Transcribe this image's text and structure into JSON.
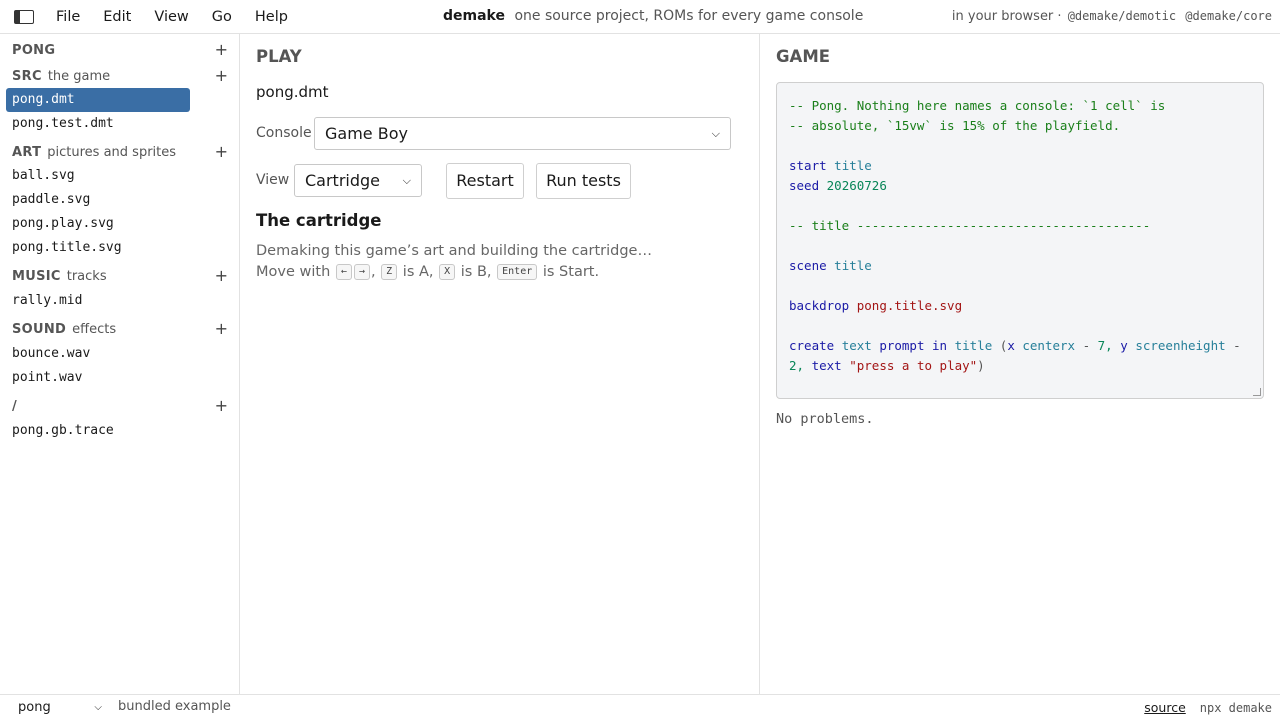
{
  "menubar": {
    "items": [
      "File",
      "Edit",
      "View",
      "Go",
      "Help"
    ],
    "brand": "demake",
    "tagline": "one source project, ROMs for every game console",
    "right_text": "in your browser ·",
    "packages": [
      "@demake/demotic",
      "@demake/core"
    ]
  },
  "sidebar": {
    "sections": [
      {
        "title": "PONG",
        "subtitle": "",
        "files": []
      },
      {
        "title": "SRC",
        "subtitle": "the game",
        "files": [
          "pong.dmt",
          "pong.test.dmt"
        ]
      },
      {
        "title": "ART",
        "subtitle": "pictures and sprites",
        "files": [
          "ball.svg",
          "paddle.svg",
          "pong.play.svg",
          "pong.title.svg"
        ]
      },
      {
        "title": "MUSIC",
        "subtitle": "tracks",
        "files": [
          "rally.mid"
        ]
      },
      {
        "title": "SOUND",
        "subtitle": "effects",
        "files": [
          "bounce.wav",
          "point.wav"
        ]
      },
      {
        "title": "/",
        "subtitle": "",
        "files": [
          "pong.gb.trace"
        ]
      }
    ],
    "add_label": "+",
    "active_file": "pong.dmt"
  },
  "play": {
    "title": "PLAY",
    "file": "pong.dmt",
    "console_label": "Console",
    "console_value": "Game Boy",
    "view_label": "View",
    "view_value": "Cartridge",
    "restart": "Restart",
    "run_tests": "Run tests",
    "cart_title": "The cartridge",
    "cart_line1": "Demaking this game’s art and building the cartridge…",
    "move_with": "Move with",
    "keys": [
      "←",
      "→",
      "Z",
      "X",
      "Enter"
    ],
    "is_a": "is A,",
    "is_b": "is B,",
    "is_start": "is Start."
  },
  "game": {
    "title": "GAME",
    "code": {
      "comment1": "-- Pong. Nothing here names a console: `1 cell` is",
      "comment2": "-- absolute, `15vw` is 15% of the playfield.",
      "start_kw": "start",
      "start_val": "title",
      "seed_kw": "seed",
      "seed_val": "20260726",
      "title_comment": "-- title ---------------------------------------",
      "scene_kw": "scene",
      "scene_val": "title",
      "backdrop_kw": "backdrop",
      "backdrop_val": "pong.title.svg",
      "create_kw": "create",
      "create_type": "text",
      "create_name": "prompt",
      "in_kw": "in",
      "in_val": "title",
      "paren_open": "(",
      "x_kw": "x",
      "centerx": "centerx",
      "minus": "-",
      "seven": "7,",
      "y_kw": "y",
      "screenheight": "screenheight",
      "minus2": "-",
      "two": "2,",
      "text_kw": "text",
      "text_val": "\"press a to play\"",
      "paren_close": ")"
    },
    "problems": "No problems."
  },
  "statusbar": {
    "example": "pong",
    "example_note": "bundled example",
    "source": "source",
    "npx": "npx demake"
  }
}
